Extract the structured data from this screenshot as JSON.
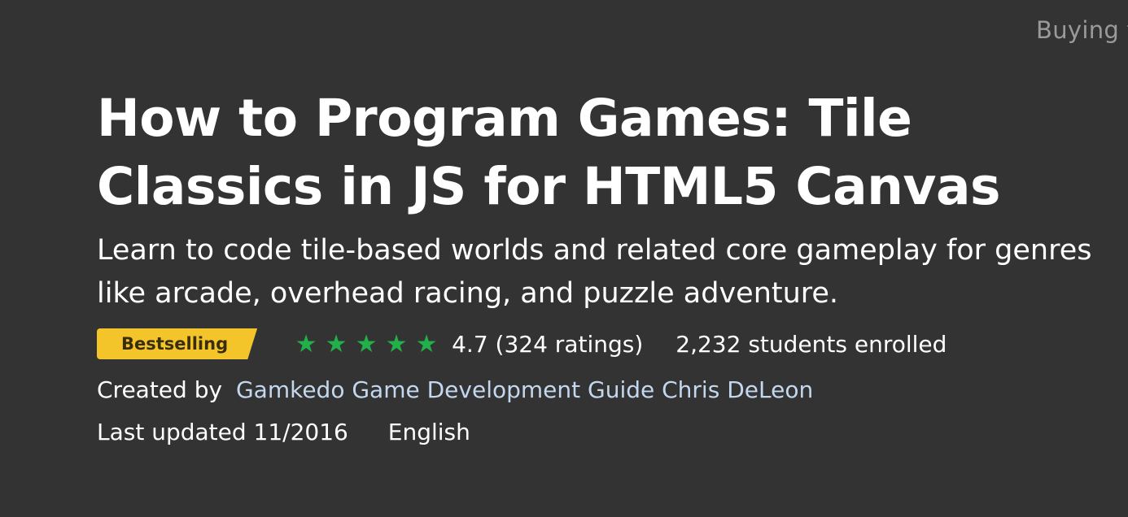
{
  "top_bar": {
    "buying_for": "Buying f"
  },
  "course": {
    "title": "How to Program Games: Tile Classics in JS for HTML5 Canvas",
    "subtitle": "Learn to code tile-based worlds and related core gameplay for genres like arcade, overhead racing, and puzzle adventure.",
    "badge": "Bestselling",
    "rating": {
      "stars_icon": "star-icon",
      "stars": 4.7,
      "text": "4.7 (324 ratings)"
    },
    "students": "2,232 students enrolled",
    "created_by_label": "Created by",
    "creator": "Gamkedo Game Development Guide Chris DeLeon",
    "last_updated": "Last updated 11/2016",
    "language": "English"
  },
  "colors": {
    "background": "#333333",
    "badge": "#f3c52a",
    "stars": "#22b04a",
    "link": "#c3d7ef"
  }
}
